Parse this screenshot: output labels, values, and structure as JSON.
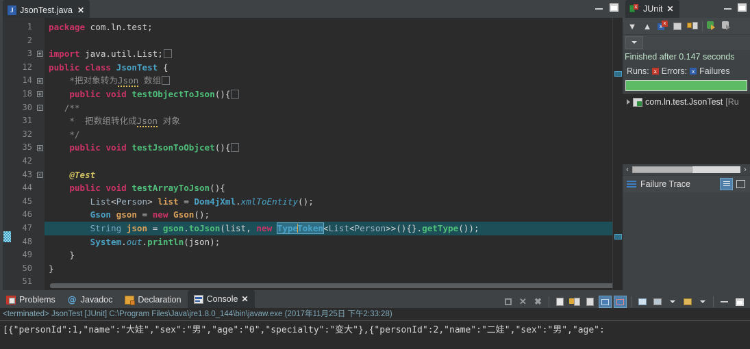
{
  "editor": {
    "tab": {
      "label": "JsonTest.java",
      "icon": "java-file-icon",
      "close": "✕"
    },
    "window_controls": {
      "minimize": "minimize-icon",
      "maximize": "maximize-icon"
    },
    "lines": [
      {
        "num": "1",
        "fold": "",
        "text": "package com.ln.test;"
      },
      {
        "num": "2",
        "fold": "",
        "text": ""
      },
      {
        "num": "3",
        "fold": "+",
        "text": "import java.util.List;"
      },
      {
        "num": "12",
        "fold": "",
        "text": "public class JsonTest {"
      },
      {
        "num": "14",
        "fold": "+",
        "text": "    *把对象转为 Json 数组"
      },
      {
        "num": "18",
        "fold": "+",
        "text": "    public void testObjectToJson(){"
      },
      {
        "num": "30",
        "fold": "-",
        "text": "    /**"
      },
      {
        "num": "31",
        "fold": "",
        "text": "     *  把数组转化成 Json 对象"
      },
      {
        "num": "32",
        "fold": "",
        "text": "     */"
      },
      {
        "num": "35",
        "fold": "+",
        "text": "    public void testJsonToObjcet(){"
      },
      {
        "num": "42",
        "fold": "",
        "text": ""
      },
      {
        "num": "43",
        "fold": "-",
        "text": "    @Test"
      },
      {
        "num": "44",
        "fold": "",
        "text": "    public void testArrayToJson(){"
      },
      {
        "num": "45",
        "fold": "",
        "text": "        List<Person> list = Dom4jXml.xmlToEntity();"
      },
      {
        "num": "46",
        "fold": "",
        "text": "        Gson gson = new Gson();"
      },
      {
        "num": "47",
        "fold": "",
        "text": "        String json = gson.toJson(list, new TypeToken<List<Person>>(){}.getType());"
      },
      {
        "num": "48",
        "fold": "",
        "text": "        System.out.println(json);"
      },
      {
        "num": "49",
        "fold": "",
        "text": "    }"
      },
      {
        "num": "50",
        "fold": "",
        "text": "}"
      },
      {
        "num": "51",
        "fold": "",
        "text": ""
      }
    ],
    "tokens": {
      "kw_package": "package",
      "pkg_name": "com.ln.test;",
      "kw_import": "import",
      "import_name": "java.util.List;",
      "kw_public": "public",
      "kw_class": "class",
      "cls_jsontest": "JsonTest",
      "brace_open": "{",
      "comment_14": "*把对象转为",
      "comment_json": "Json",
      "comment_array": "数组",
      "kw_void": "void",
      "m_testObjectToJson": "testObjectToJson",
      "m_testJsonToObjcet": "testJsonToObjcet",
      "m_testArrayToJson": "testArrayToJson",
      "comment_open": "/**",
      "comment_star": "*",
      "comment_31": "把数组转化成",
      "comment_obj": "对象",
      "comment_close": "*/",
      "annotation_test": "@Test",
      "t_List": "List",
      "t_Person": "Person",
      "v_list": "list",
      "c_Dom4jXml": "Dom4jXml",
      "m_xmlToEntity": "xmlToEntity",
      "c_Gson": "Gson",
      "v_gson": "gson",
      "kw_new": "new",
      "t_String": "String",
      "v_json": "json",
      "m_toJson": "toJson",
      "sel_Type": "Type",
      "sel_Token": "Token",
      "c_TypeToken": "TypeToken",
      "m_getType": "getType",
      "c_System": "System",
      "f_out": "out",
      "m_println": "println",
      "brace_close": "}"
    },
    "scroll": {
      "h_position": "near-left"
    }
  },
  "junit": {
    "tab": {
      "label": "JUnit",
      "icon": "junit-icon",
      "close": "✕"
    },
    "window_controls": {
      "minimize": "minimize-icon",
      "maximize": "maximize-icon"
    },
    "toolbar": [
      {
        "name": "next-failure-icon",
        "glyph": "↓"
      },
      {
        "name": "previous-failure-icon",
        "glyph": "↑"
      },
      {
        "name": "show-failures-only-icon",
        "glyph": "x"
      },
      {
        "name": "stop-junit-icon",
        "glyph": "⊘"
      },
      {
        "name": "scroll-lock-icon",
        "glyph": "ὑ2"
      },
      {
        "name": "rerun-test-icon",
        "glyph": "▶"
      },
      {
        "name": "rerun-failed-icon",
        "glyph": "▶"
      }
    ],
    "toolbar_overflow": "view-menu-icon",
    "status": "Finished after 0.147 seconds",
    "counters": [
      {
        "label": "Runs:",
        "value": "",
        "icon": ""
      },
      {
        "label": "Errors:",
        "value": "",
        "icon": "error-square-icon"
      },
      {
        "label": "Failures",
        "value": "",
        "icon": "failure-square-icon"
      }
    ],
    "progress": {
      "percent": 100,
      "color": "#5cbb64"
    },
    "tree": [
      {
        "expander": "▷",
        "icon": "test-class-icon",
        "label": "com.ln.test.JsonTest",
        "suffix": "[Ru"
      }
    ],
    "failure_trace": {
      "label": "Failure Trace",
      "icon": "failure-trace-icon",
      "tools": [
        "filter-stack-trace-icon",
        "compare-result-icon"
      ]
    },
    "hscroll": {
      "left_arrow": "‹",
      "right_arrow": "›"
    }
  },
  "bottom": {
    "tabs": [
      {
        "label": "Problems",
        "icon": "problems-icon",
        "active": false
      },
      {
        "label": "Javadoc",
        "icon": "javadoc-icon",
        "active": false
      },
      {
        "label": "Declaration",
        "icon": "declaration-icon",
        "active": false
      },
      {
        "label": "Console",
        "icon": "console-icon",
        "active": true,
        "close": "✕"
      }
    ],
    "toolbar": [
      {
        "name": "terminate-icon",
        "glyph": "■"
      },
      {
        "name": "remove-launch-icon",
        "glyph": "✕"
      },
      {
        "name": "remove-all-terminated-icon",
        "glyph": "✗"
      },
      {
        "name": "clear-console-icon",
        "glyph": "≡"
      },
      {
        "name": "scroll-lock-icon",
        "glyph": "ὑ2"
      },
      {
        "name": "word-wrap-icon",
        "glyph": "↵"
      },
      {
        "name": "show-console-on-output-icon",
        "glyph": "▤",
        "selected": true
      },
      {
        "name": "show-console-on-error-icon",
        "glyph": "▤",
        "selected": true
      },
      {
        "name": "pin-console-icon",
        "glyph": "▣"
      },
      {
        "name": "display-selected-console-icon",
        "glyph": "▤"
      },
      {
        "name": "display-selected-console-dropdown-icon",
        "glyph": "▾"
      },
      {
        "name": "open-console-icon",
        "glyph": "▤"
      },
      {
        "name": "open-console-dropdown-icon",
        "glyph": "▾"
      },
      {
        "name": "minimize-icon",
        "glyph": "–"
      },
      {
        "name": "maximize-icon",
        "glyph": "□"
      }
    ],
    "console": {
      "terminated_line": "<terminated> JsonTest [JUnit] C:\\Program Files\\Java\\jre1.8.0_144\\bin\\javaw.exe (2017年11月25日 下午2:33:28)",
      "output": "[{\"personId\":1,\"name\":\"大娃\",\"sex\":\"男\",\"age\":\"0\",\"specialty\":\"变大\"},{\"personId\":2,\"name\":\"二娃\",\"sex\":\"男\",\"age\":"
    }
  },
  "colors": {
    "editor_bg": "#2b2b2b",
    "gutter_bg": "#313335",
    "chrome_bg": "#3f4245",
    "tab_active_bg": "#2f3234",
    "keyword": "#cc3366",
    "class_name": "#4aa3c7",
    "method": "#4fbf7a",
    "field": "#d8a05a",
    "comment": "#8d8d8d",
    "annotation": "#d0c060",
    "selection": "#2f6f86",
    "current_line": "#1d4f58",
    "progress_green": "#5cbb64",
    "console_terminated": "#7fa8b8"
  }
}
